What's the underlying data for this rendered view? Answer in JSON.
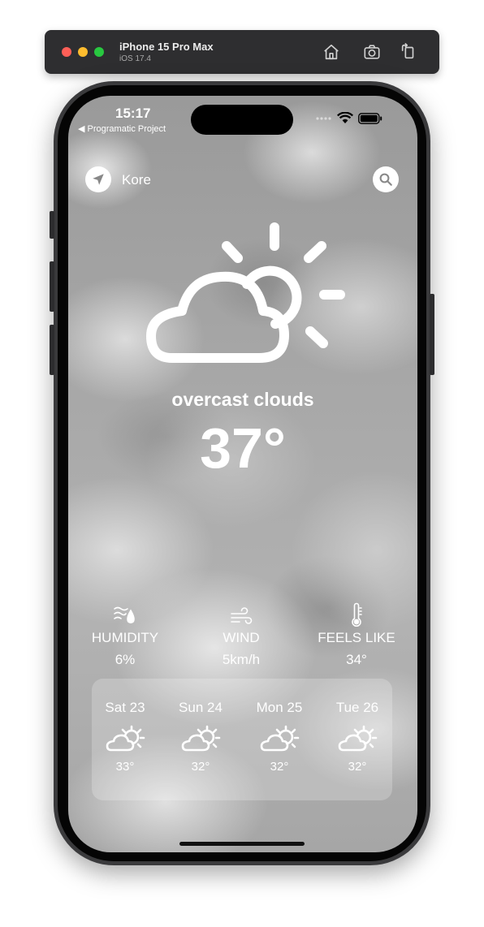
{
  "simulator": {
    "device_name": "iPhone 15 Pro Max",
    "os_version": "iOS 17.4"
  },
  "status_bar": {
    "time": "15:17",
    "back_label": "◀ Programatic Project"
  },
  "header": {
    "city": "Kore"
  },
  "current": {
    "description": "overcast clouds",
    "temperature": "37°"
  },
  "stats": [
    {
      "icon": "humidity-icon",
      "label": "HUMIDITY",
      "value": "6%"
    },
    {
      "icon": "wind-icon",
      "label": "WIND",
      "value": "5km/h"
    },
    {
      "icon": "thermometer-icon",
      "label": "FEELS LIKE",
      "value": "34°"
    }
  ],
  "forecast": [
    {
      "day": "Sat 23",
      "icon": "partly-cloudy-icon",
      "temp": "33°"
    },
    {
      "day": "Sun 24",
      "icon": "partly-cloudy-icon",
      "temp": "32°"
    },
    {
      "day": "Mon 25",
      "icon": "partly-cloudy-icon",
      "temp": "32°"
    },
    {
      "day": "Tue 26",
      "icon": "partly-cloudy-icon",
      "temp": "32°"
    }
  ]
}
